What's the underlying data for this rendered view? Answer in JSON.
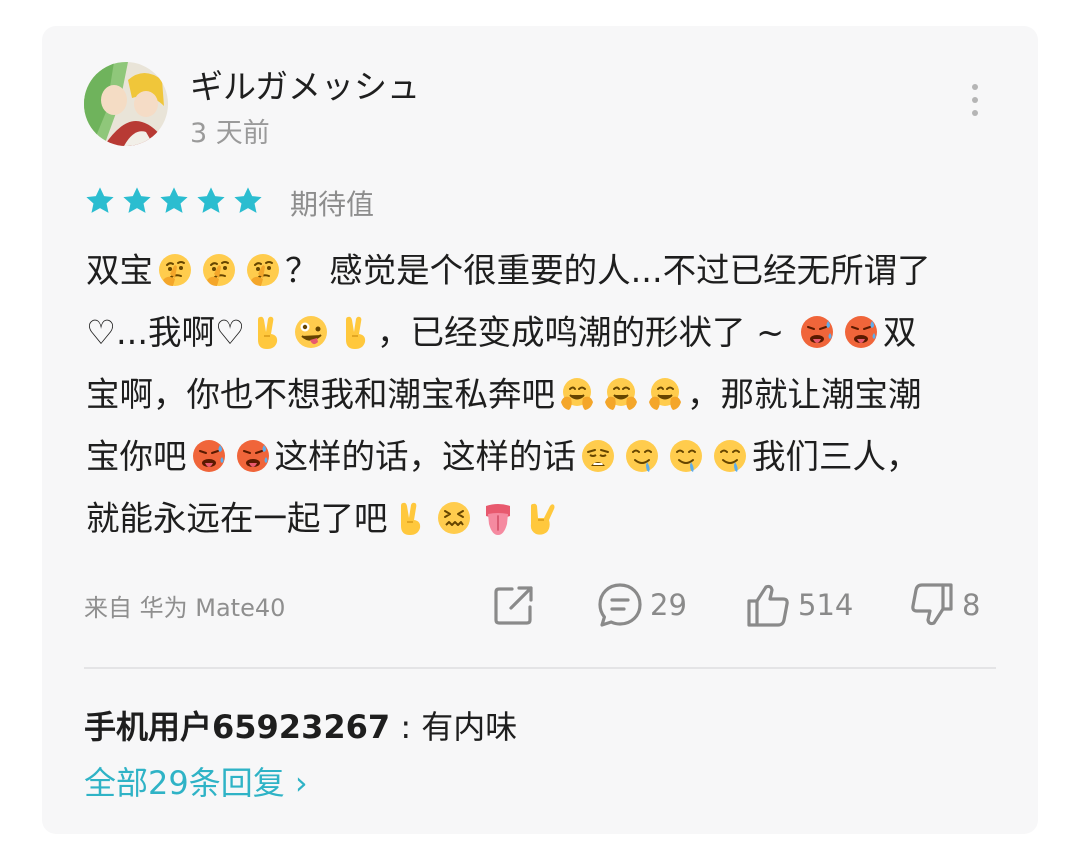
{
  "comment": {
    "username": "ギルガメッシュ",
    "time": "3 天前",
    "rating_stars": 5,
    "rating_label": "期待值",
    "lines": [
      [
        {
          "t": "双宝"
        },
        {
          "e": "think"
        },
        {
          "e": "think"
        },
        {
          "e": "think"
        },
        {
          "t": "？ 感觉是个很重要的人...不过已经无所谓了"
        }
      ],
      [
        {
          "t": "♡...我啊♡"
        },
        {
          "e": "victory"
        },
        {
          "e": "zany"
        },
        {
          "e": "victory"
        },
        {
          "t": "，已经变成鸣潮的形状了 ~ "
        },
        {
          "e": "hot"
        },
        {
          "e": "hot"
        },
        {
          "t": "双"
        }
      ],
      [
        {
          "t": "宝啊，你也不想我和潮宝私奔吧"
        },
        {
          "e": "hug"
        },
        {
          "e": "hug"
        },
        {
          "e": "hug"
        },
        {
          "t": "，那就让潮宝潮"
        }
      ],
      [
        {
          "t": "宝你吧"
        },
        {
          "e": "hot"
        },
        {
          "e": "hot"
        },
        {
          "t": "这样的话，这样的话"
        },
        {
          "e": "weary"
        },
        {
          "e": "drool"
        },
        {
          "e": "drool"
        },
        {
          "e": "drool"
        },
        {
          "t": "我们三人，"
        }
      ],
      [
        {
          "t": "就能永远在一起了吧"
        },
        {
          "e": "victory"
        },
        {
          "e": "confounded"
        },
        {
          "e": "tongue"
        },
        {
          "e": "rock"
        }
      ]
    ],
    "device": "来自 华为 Mate40",
    "comments_count": "29",
    "likes_count": "514",
    "dislikes_count": "8"
  },
  "reply": {
    "author": "手机用户65923267",
    "separator": " : ",
    "text": "有内味"
  },
  "all_replies_label": "全部29条回复 ›",
  "colors": {
    "accent": "#2fb3c6",
    "card_bg": "#f7f7f8",
    "star": "#2bbdd0",
    "icon_gray": "#8a8a8a"
  }
}
